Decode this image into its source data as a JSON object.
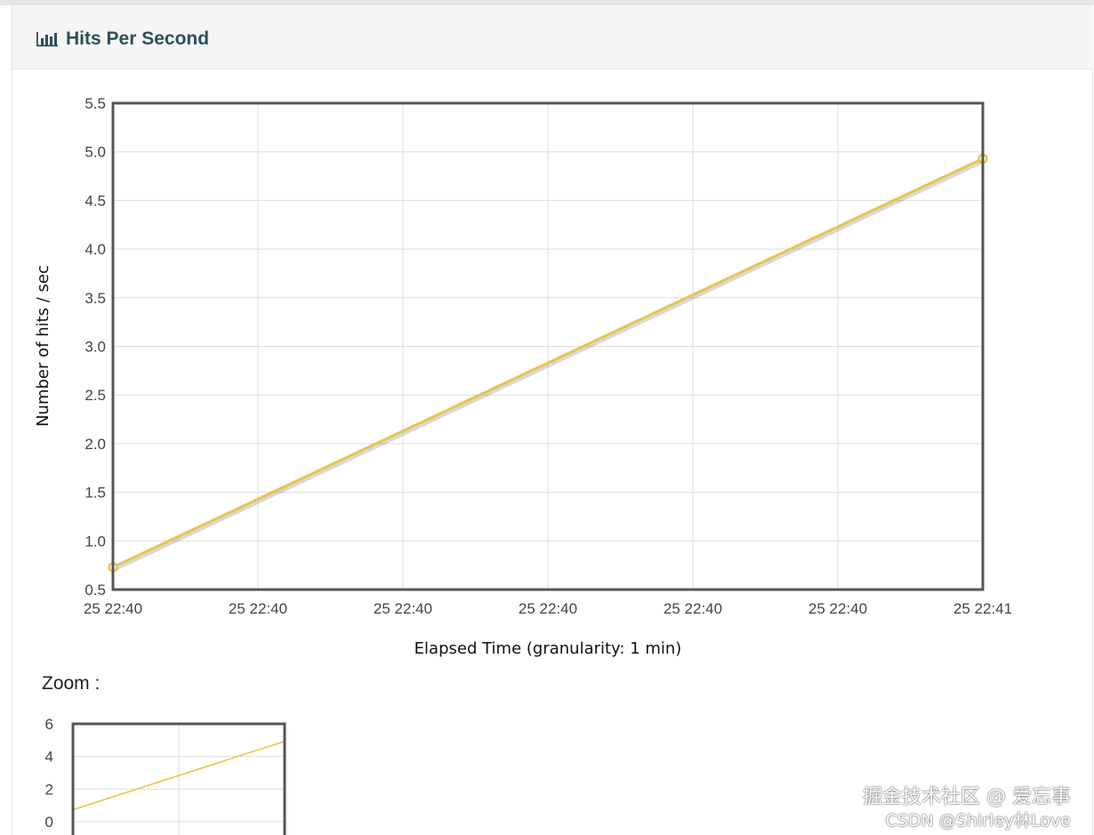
{
  "panel": {
    "title": "Hits Per Second",
    "icon": "bar-chart-icon"
  },
  "chart_data": [
    {
      "type": "line",
      "xlabel": "Elapsed Time (granularity: 1 min)",
      "ylabel": "Number of hits / sec",
      "x_tick_labels": [
        "25 22:40",
        "25 22:40",
        "25 22:40",
        "25 22:40",
        "25 22:40",
        "25 22:40",
        "25 22:41"
      ],
      "y_ticks": [
        "0.5",
        "1.0",
        "1.5",
        "2.0",
        "2.5",
        "3.0",
        "3.5",
        "4.0",
        "4.5",
        "5.0",
        "5.5"
      ],
      "ylim": [
        0.5,
        5.5
      ],
      "x_points": [
        0,
        1
      ],
      "values": [
        0.73,
        4.93
      ],
      "line_color": "#e8c54a",
      "grid": true
    },
    {
      "type": "line",
      "role": "zoom-overview",
      "ylim": [
        0,
        6
      ],
      "y_ticks": [
        "0",
        "2",
        "4",
        "6"
      ],
      "x_points": [
        0,
        1
      ],
      "values": [
        0.73,
        4.93
      ],
      "line_color": "#e8c54a",
      "grid": true
    }
  ],
  "zoom": {
    "label": "Zoom :"
  },
  "watermark": {
    "line1": "掘金技术社区 @ 爱忘事",
    "line2": "CSDN @Shirley林Love"
  }
}
